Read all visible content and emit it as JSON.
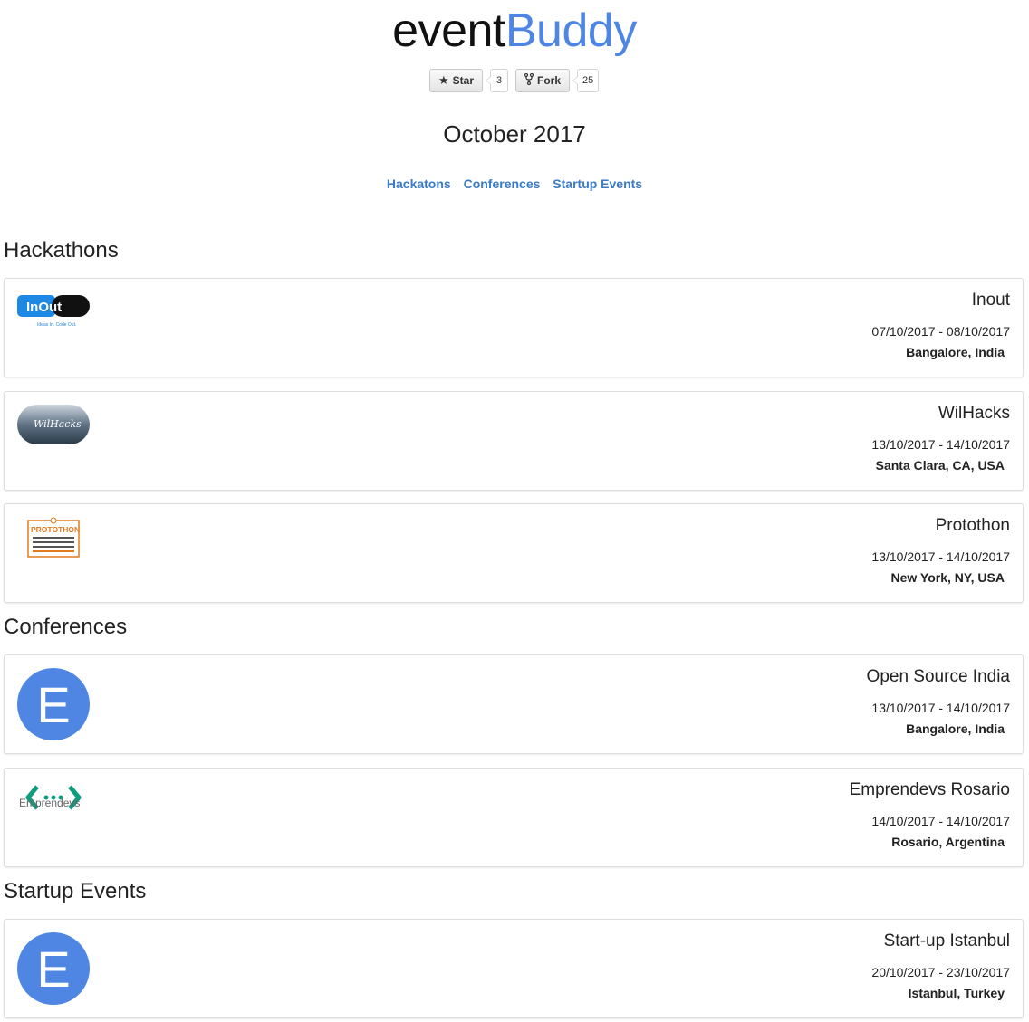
{
  "brand": {
    "part1": "event",
    "part2": "Buddy",
    "accent": "#4f86e4"
  },
  "github": {
    "star_label": "Star",
    "star_count": "3",
    "fork_label": "Fork",
    "fork_count": "25"
  },
  "month_title": "October 2017",
  "nav": {
    "links": [
      "Hackatons",
      "Conferences",
      "Startup Events"
    ],
    "link_color": "#3a7bc8"
  },
  "sections": {
    "hackathons": {
      "title": "Hackathons",
      "events": [
        {
          "name": "Inout",
          "dates": "07/10/2017 - 08/10/2017",
          "location": "Bangalore, India",
          "logo_text": "InOut",
          "logo_sub": "Ideas In. Code Out."
        },
        {
          "name": "WilHacks",
          "dates": "13/10/2017 - 14/10/2017",
          "location": "Santa Clara, CA, USA",
          "logo_text": "WilHacks"
        },
        {
          "name": "Protothon",
          "dates": "13/10/2017 - 14/10/2017",
          "location": "New York, NY, USA",
          "logo_text": "PROTOTHON"
        }
      ]
    },
    "conferences": {
      "title": "Conferences",
      "events": [
        {
          "name": "Open Source India",
          "dates": "13/10/2017 - 14/10/2017",
          "location": "Bangalore, India",
          "logo_letter": "E"
        },
        {
          "name": "Emprendevs Rosario",
          "dates": "14/10/2017 - 14/10/2017",
          "location": "Rosario, Argentina",
          "logo_text": "Emprendevs"
        }
      ]
    },
    "startups": {
      "title": "Startup Events",
      "events": [
        {
          "name": "Start-up Istanbul",
          "dates": "20/10/2017 - 23/10/2017",
          "location": "Istanbul, Turkey",
          "logo_letter": "E"
        }
      ]
    }
  }
}
